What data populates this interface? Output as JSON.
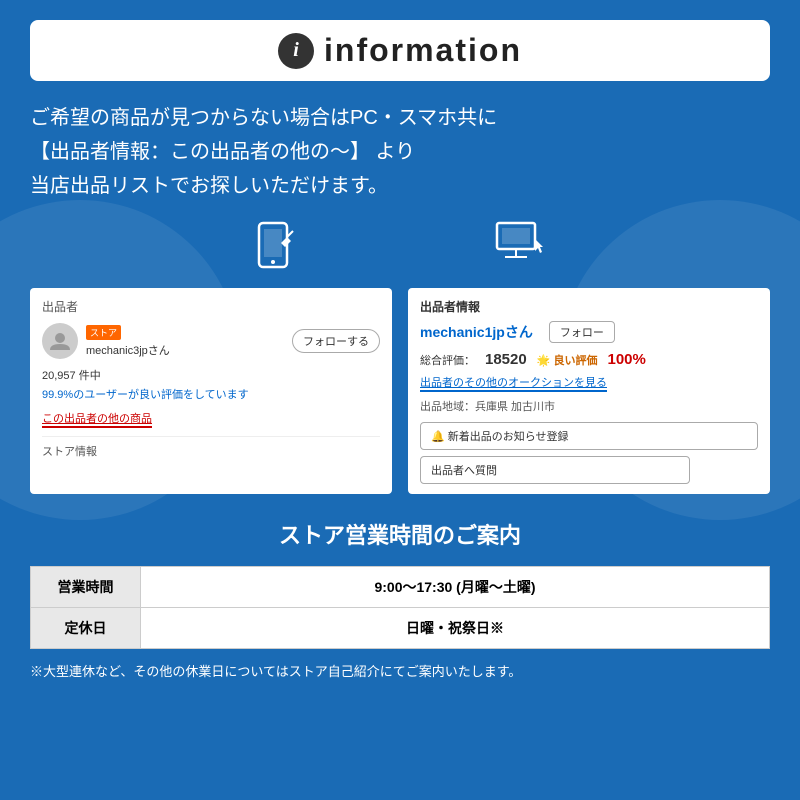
{
  "header": {
    "icon_label": "i",
    "title": "information"
  },
  "main_text": {
    "line1": "ご希望の商品が見つからない場合はPC・スマホ共に",
    "line2": "【出品者情報：この出品者の他の〜】 より",
    "line3": "当店出品リストでお探しいただけます。"
  },
  "left_screenshot": {
    "section": "出品者",
    "store_badge": "ストア",
    "seller_name": "mechanic3jpさん",
    "follow_label": "フォローする",
    "count": "20,957 件中",
    "percent_text": "99.9%のユーザーが良い評価をしています",
    "other_items": "この出品者の他の商品",
    "store_info": "ストア情報"
  },
  "right_screenshot": {
    "title": "出品者情報",
    "seller_name": "mechanic1jpさん",
    "follow_label": "フォロー",
    "rating_label": "総合評価：",
    "rating_num": "18520",
    "good_label": "🌟 良い評価",
    "good_pct": "100%",
    "auction_link": "出品者のその他のオークションを見る",
    "location_label": "出品地域：兵庫県 加古川市",
    "notif_btn": "🔔 新着出品のお知らせ登録",
    "question_btn": "出品者へ質問"
  },
  "store_hours": {
    "title": "ストア営業時間のご案内",
    "rows": [
      {
        "label": "営業時間",
        "value": "9:00〜17:30 (月曜〜土曜)"
      },
      {
        "label": "定休日",
        "value": "日曜・祝祭日※"
      }
    ],
    "footnote": "※大型連休など、その他の休業日についてはストア自己紹介にてご案内いたします。"
  }
}
